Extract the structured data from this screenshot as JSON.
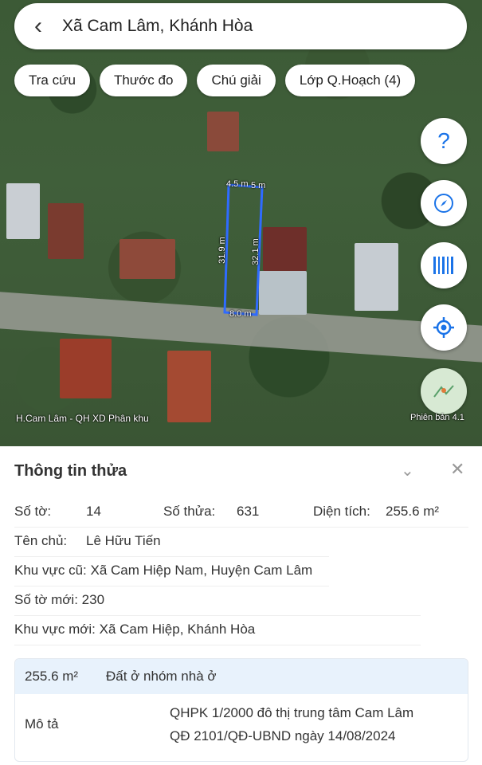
{
  "search": {
    "title": "Xã Cam Lâm, Khánh Hòa"
  },
  "chips": [
    "Tra cứu",
    "Thước đo",
    "Chú giải",
    "Lớp Q.Hoạch (4)"
  ],
  "fab_icons": [
    "help-icon",
    "compass-icon",
    "barcode-icon",
    "locate-icon",
    "map-layer-icon"
  ],
  "map": {
    "layer_label": "H.Cam Lâm - QH XD Phân khu",
    "version": "Phiên bản 4.1",
    "measures": {
      "top_left": "4.5 m",
      "top_right": "5 m",
      "left": "31.9 m",
      "right": "32.1 m",
      "bottom": "8.0 m"
    }
  },
  "panel": {
    "title": "Thông tin thửa",
    "so_to_label": "Số tờ:",
    "so_to": "14",
    "so_thua_label": "Số thửa:",
    "so_thua": "631",
    "dien_tich_label": "Diện tích:",
    "dien_tich": "255.6 m²",
    "ten_chu_label": "Tên chủ:",
    "ten_chu": "Lê Hữu Tiến",
    "khu_vuc_cu_label": "Khu vực cũ:",
    "khu_vuc_cu": "Xã Cam Hiệp Nam, Huyện Cam Lâm",
    "so_to_moi_label": "Số tờ mới:",
    "so_to_moi": "230",
    "khu_vuc_moi_label": "Khu vực mới:",
    "khu_vuc_moi": "Xã Cam Hiệp, Khánh Hòa",
    "card": {
      "area": "255.6 m²",
      "land_type": "Đất ở nhóm nhà ở",
      "desc_label": "Mô tả",
      "desc_line1": "QHPK 1/2000 đô thị trung tâm Cam Lâm",
      "desc_line2": "QĐ 2101/QĐ-UBND ngày 14/08/2024"
    }
  }
}
